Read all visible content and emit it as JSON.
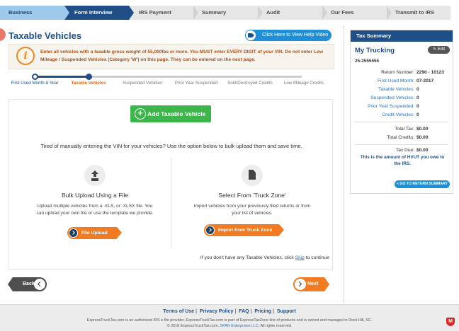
{
  "steps": [
    {
      "label": "Business",
      "state": "done"
    },
    {
      "label": "Form Interview",
      "state": "active"
    },
    {
      "label": "IRS Payment",
      "state": "pending"
    },
    {
      "label": "Summary",
      "state": "pending"
    },
    {
      "label": "Audit",
      "state": "pending"
    },
    {
      "label": "Our Fees",
      "state": "pending"
    },
    {
      "label": "Transmit to IRS",
      "state": "pending"
    }
  ],
  "page": {
    "title": "Taxable Vehicles",
    "video_button": "Click Here to View Help Video"
  },
  "notice": {
    "icon_letter": "i",
    "text": "Enter all vehicles with a taxable gross weight of 55,000lbs or more. You MUST enter EVERY DIGIT of your VIN. Do not enter Low Mileage / Suspended Vehicles (Category 'W') on this page. They can be entered on the next page."
  },
  "wizard": [
    {
      "label": "First Used Month & Year",
      "state": "done"
    },
    {
      "label": "Taxable Vehicles",
      "state": "active"
    },
    {
      "label": "Suspended Vehicles",
      "state": "pending"
    },
    {
      "label": "Prior Year Suspended",
      "state": "pending"
    },
    {
      "label": "Sold/Destroyed Credits",
      "state": "pending"
    },
    {
      "label": "Low Mileage Credits",
      "state": "pending"
    }
  ],
  "main": {
    "add_button": "Add Taxable Vehicle",
    "tired_text": "Tired of manually entering the VIN for your vehicles?  Use the option below to bulk upload them and save time.",
    "bulk": {
      "title": "Bulk Upload Using a File",
      "desc": "Upload multiple vehicles from a .XLS, or .XLSX file. You can upload your own file or use the template we provide.",
      "button": "File Upload"
    },
    "truckzone": {
      "title": "Select From 'Truck Zone'",
      "desc": "Import vehicles from your previously filed returns or from your list of vehicles.",
      "button": "Import from Truck Zone"
    },
    "skip_prefix": "If you don't have any Taxable Vehicles, click",
    "skip_link": "Skip",
    "skip_suffix": "to continue"
  },
  "nav": {
    "back": "Back",
    "next": "Next"
  },
  "tax_summary": {
    "header": "Tax Summary",
    "company": "My Trucking",
    "edit": "Edit",
    "ein": "25-2555555",
    "return_number_label": "Return Number:",
    "return_number": "2290 - 10123",
    "first_used_label": "First Used Month:",
    "first_used": "07-2017",
    "taxable_label": "Taxable Vehicles:",
    "taxable": "0",
    "suspended_label": "Suspended Vehicles:",
    "suspended": "0",
    "prior_label": "Prior Year Suspended:",
    "prior": "0",
    "credit_label": "Credit Vehicles:",
    "credit": "0",
    "total_tax_label": "Total Tax:",
    "total_tax": "$0.00",
    "total_credits_label": "Total Credits:",
    "total_credits": "$0.00",
    "tax_due_label": "Tax Due:",
    "tax_due": "$0.00",
    "note": "This is the amount of HVUT you owe to the IRS.",
    "return_button": "« GO TO RETURN SUMMARY"
  },
  "footer": {
    "links": [
      "Terms of Use",
      "Privacy Policy",
      "FAQ",
      "Pricing",
      "Support"
    ],
    "line1": "ExpressTruckTax.com is an authorized IRS e-file provider. ExpressTruckTax.com is part of ExpressTaxZone line of products and is owned and managed in Rock Hill, SC.",
    "line2_prefix": "© 2018 ExpressTruckTax.com,",
    "line2_company": "SPAN Enterprises LLC",
    "line2_suffix": ". All rights reserved.",
    "mcafee_letter": "M"
  }
}
